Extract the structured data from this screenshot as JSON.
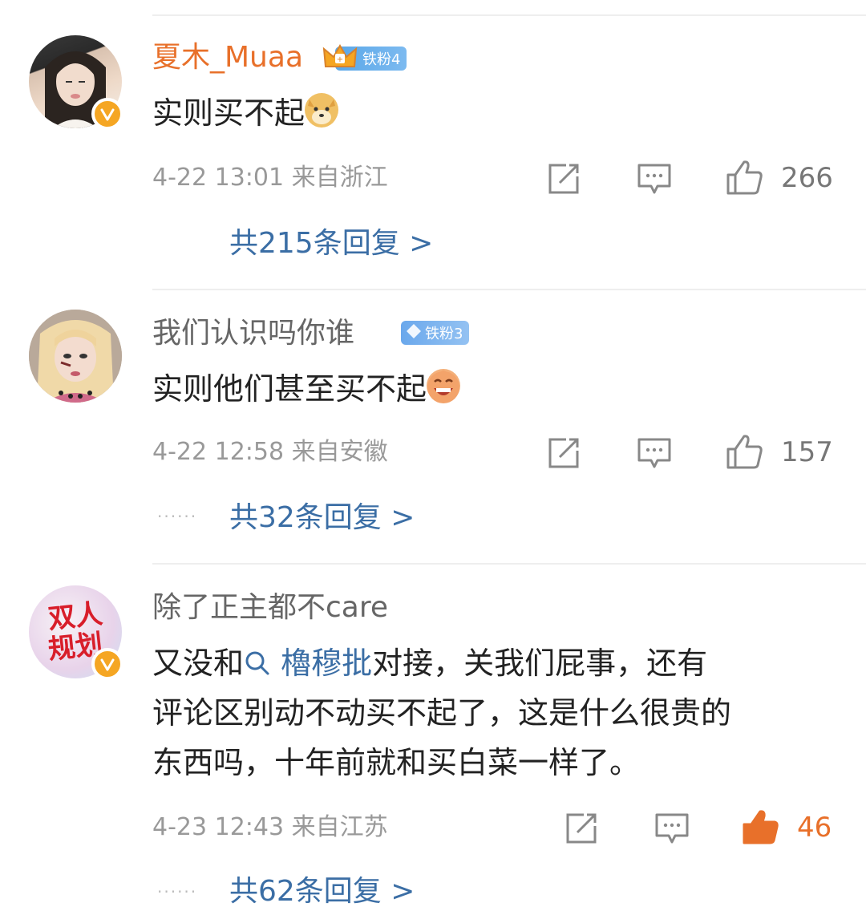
{
  "comments": [
    {
      "username": "夏木_Muaa",
      "fan_badge": "铁粉4",
      "text": "实则买不起",
      "emoji": "doge-emoji",
      "time_location": "4-22 13:01 来自浙江",
      "likes": "266",
      "liked": false,
      "replies": "共215条回复 >"
    },
    {
      "username": "我们认识吗你谁",
      "fan_badge": "铁粉3",
      "text": "实则他们甚至买不起",
      "emoji": "laughing-emoji",
      "time_location": "4-22 12:58 来自安徽",
      "likes": "157",
      "liked": false,
      "replies_dots": "······",
      "replies": "共32条回复 >"
    },
    {
      "username": "除了正主都不care",
      "avatar_text": [
        "双人",
        "规划"
      ],
      "text_lines": {
        "line1_pre": "又没和",
        "topic": "櫓穆批",
        "line1_post": "对接，关我们屁事，还有",
        "line2": "评论区别动不动买不起了，这是什么很贵的",
        "line3": "东西吗，十年前就和买白菜一样了。"
      },
      "time_location": "4-23 12:43 来自江苏",
      "likes": "46",
      "liked": true,
      "replies_dots": "······",
      "replies": "共62条回复 >"
    }
  ],
  "colors": {
    "accent_orange": "#e8702a",
    "link_blue": "#3b6ea5",
    "meta_gray": "#999999",
    "verified_gold": "#f5a623"
  }
}
